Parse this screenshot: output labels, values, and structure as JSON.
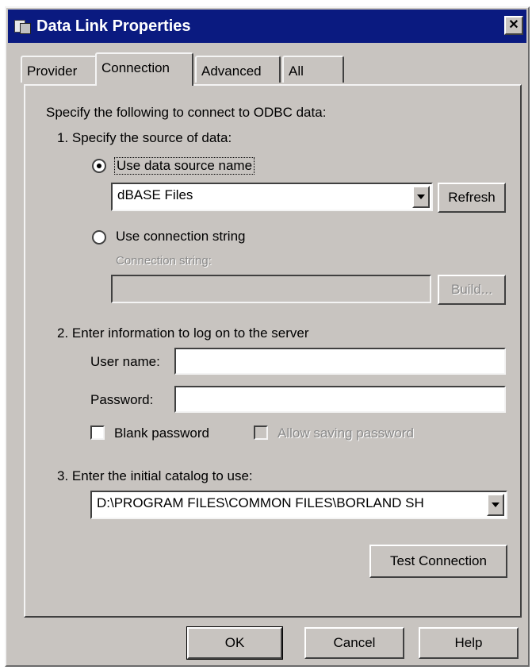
{
  "window": {
    "title": "Data Link Properties"
  },
  "tabs": [
    {
      "label": "Provider"
    },
    {
      "label": "Connection"
    },
    {
      "label": "Advanced"
    },
    {
      "label": "All"
    }
  ],
  "connection": {
    "intro": "Specify the following to connect to ODBC data:",
    "step1": "1. Specify the source of data:",
    "use_dsn_label": "Use data source name",
    "use_dsn_selected": true,
    "dsn_value": "dBASE Files",
    "refresh_label": "Refresh",
    "use_connstr_label": "Use connection string",
    "connstr_field_label": "Connection string:",
    "connstr_value": "",
    "build_label": "Build...",
    "step2": "2. Enter information to log on to the server",
    "username_label": "User name:",
    "username_value": "",
    "password_label": "Password:",
    "password_value": "",
    "blank_password_label": "Blank password",
    "allow_saving_label": "Allow saving password",
    "step3": "3. Enter the initial catalog to use:",
    "catalog_value": "D:\\PROGRAM FILES\\COMMON FILES\\BORLAND SH",
    "test_connection_label": "Test Connection"
  },
  "footer": {
    "ok_label": "OK",
    "cancel_label": "Cancel",
    "help_label": "Help"
  },
  "colors": {
    "titlebar": "#0a1a80",
    "face": "#c8c4c0"
  }
}
